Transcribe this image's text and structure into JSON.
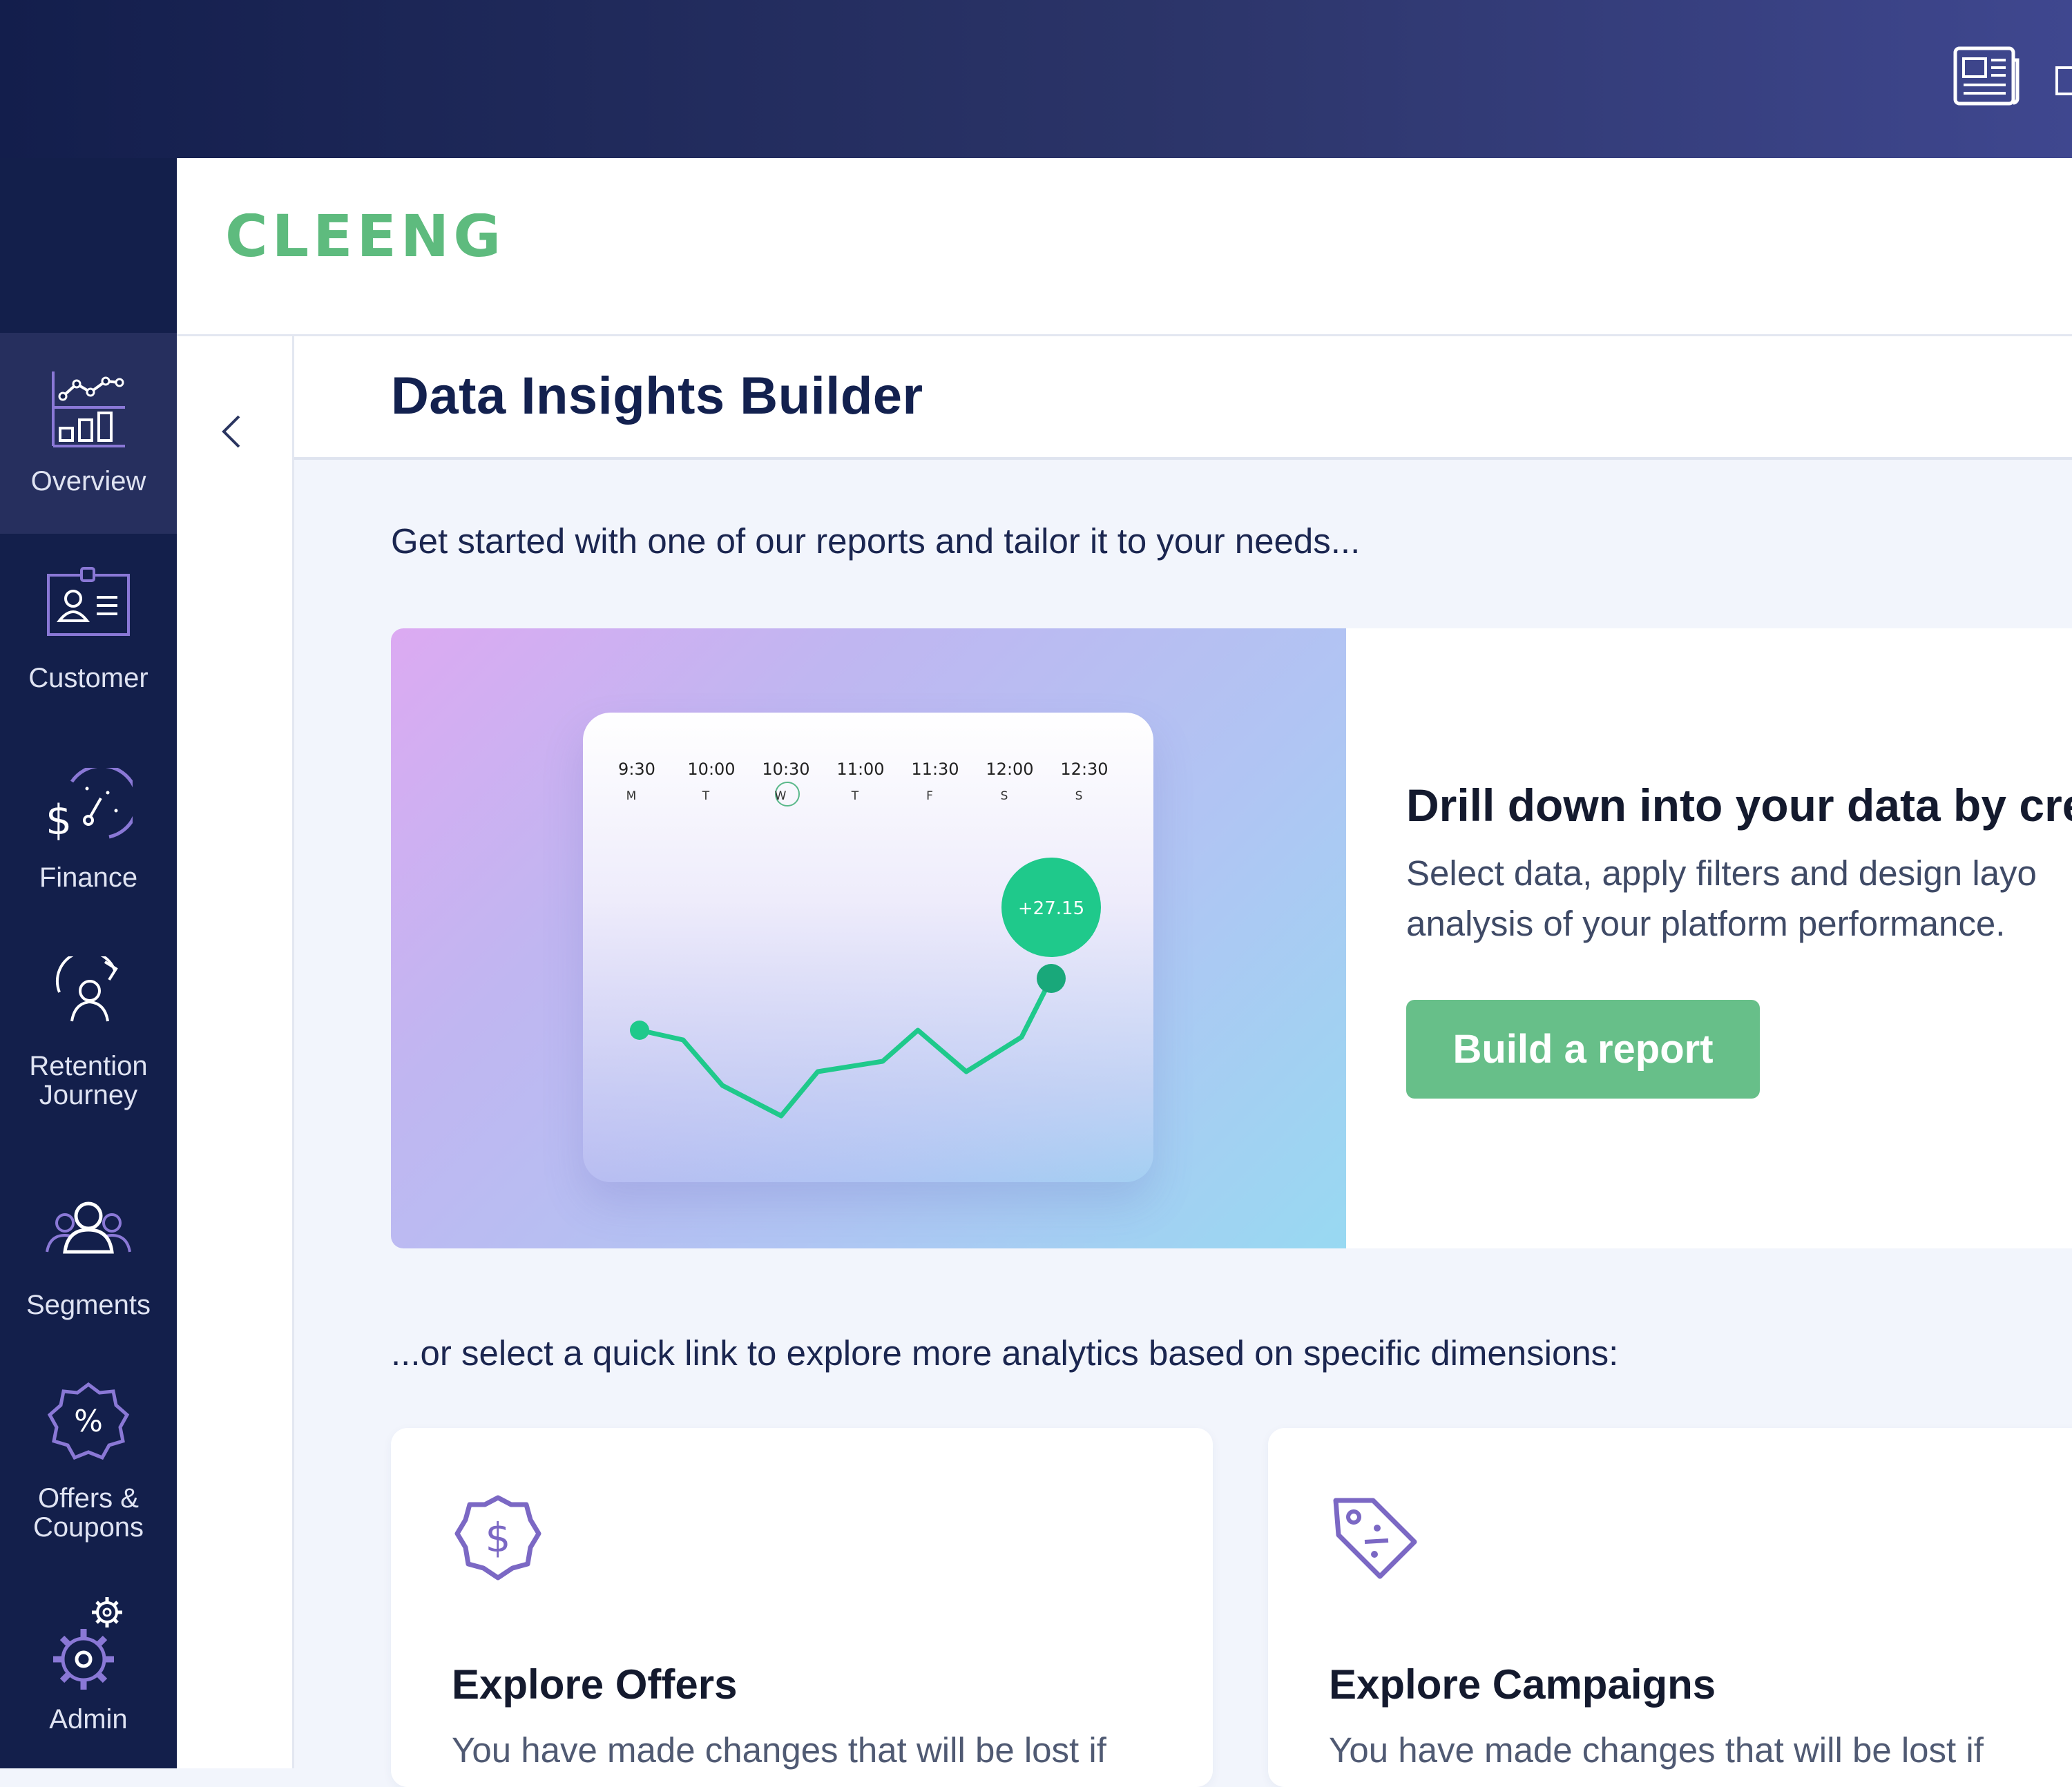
{
  "brand": {
    "logo_text": "CLEENG",
    "logo_color": "#5ebb7e"
  },
  "topbar": {
    "icons": [
      "newspaper-icon",
      "window-icon"
    ]
  },
  "sidebar": {
    "items": [
      {
        "label": "Overview",
        "icon": "overview-chart-icon",
        "active": true
      },
      {
        "label": "Customer",
        "icon": "customer-badge-icon",
        "active": false
      },
      {
        "label": "Finance",
        "icon": "finance-gauge-icon",
        "active": false
      },
      {
        "label": "Retention",
        "label2": "Journey",
        "icon": "retention-journey-icon",
        "active": false
      },
      {
        "label": "Segments",
        "icon": "segments-users-icon",
        "active": false
      },
      {
        "label": "Offers &",
        "label2": "Coupons",
        "icon": "offers-percent-icon",
        "active": false
      },
      {
        "label": "Admin",
        "icon": "admin-gear-icon",
        "active": false
      }
    ]
  },
  "page": {
    "title": "Data Insights Builder"
  },
  "intro": "Get started with one of our reports and tailor it to your needs...",
  "hero": {
    "heading": "Drill down into your data by cre",
    "description": "Select data, apply filters and design layo analysis of your platform performance.",
    "desc_line1": "Select data, apply filters and design layo",
    "desc_line2": "analysis of your platform performance.",
    "button": "Build a report"
  },
  "chart_data": {
    "type": "line",
    "x": [
      "9:30",
      "10:00",
      "10:30",
      "11:00",
      "11:30",
      "12:00",
      "12:30"
    ],
    "days": [
      "M",
      "T",
      "W",
      "T",
      "F",
      "S",
      "S"
    ],
    "selected_day": "W",
    "badge_value": "+27.15",
    "accent": "#1fc98b"
  },
  "quick_link_intro": "...or select a quick link to explore more analytics based on specific dimensions:",
  "quick_links": [
    {
      "title": "Explore Offers",
      "description": "You have made changes that will be lost if",
      "icon": "dollar-badge-icon"
    },
    {
      "title": "Explore Campaigns",
      "description": "You have made changes that will be lost if",
      "icon": "price-tag-icon"
    }
  ],
  "colors": {
    "sidebar_bg": "#131f4b",
    "icon_purple": "#7b68c4",
    "button_green": "#67bf89",
    "title_navy": "#13214f"
  }
}
